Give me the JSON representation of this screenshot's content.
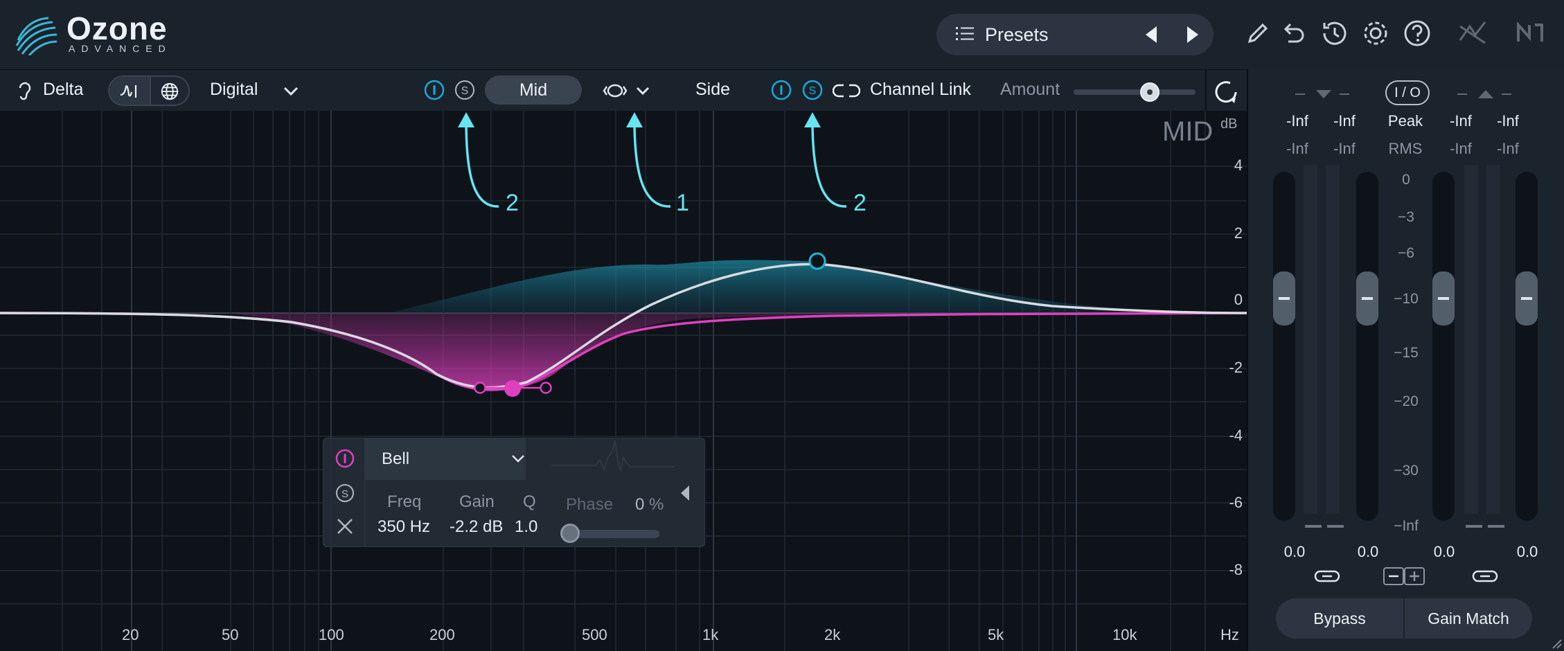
{
  "app": {
    "name": "Ozone",
    "edition": "ADVANCED"
  },
  "header": {
    "presets_label": "Presets",
    "icons": [
      "list-icon",
      "prev-preset-icon",
      "next-preset-icon",
      "pencil-icon",
      "undo-icon",
      "history-icon",
      "gear-icon",
      "help-icon",
      "signal-chain-icon",
      "ni-logo-icon"
    ]
  },
  "toolbar": {
    "delta_label": "Delta",
    "mode_label": "Digital",
    "mid_label": "Mid",
    "side_label": "Side",
    "channel_link_label": "Channel Link",
    "amount_label": "Amount",
    "amount_value": 0.62,
    "solo_letter": "S",
    "mid_power": "on",
    "side_power": "on",
    "side_solo": "on"
  },
  "eq": {
    "view_label": "MID",
    "db_unit": "dB",
    "db_ticks": [
      "4",
      "2",
      "0",
      "-2",
      "-4",
      "-6",
      "-8"
    ],
    "freq_ticks": [
      "20",
      "50",
      "100",
      "200",
      "500",
      "1k",
      "2k",
      "5k",
      "10k",
      "Hz"
    ],
    "annotations": [
      "2",
      "1",
      "2"
    ],
    "colors": {
      "mid_curve": "#e040c0",
      "side_curve": "#1ab8d8",
      "sum_curve": "#d7dbe0",
      "annotation": "#66e4f2"
    }
  },
  "band": {
    "type": "Bell",
    "freq_label": "Freq",
    "gain_label": "Gain",
    "q_label": "Q",
    "freq_value": "350 Hz",
    "gain_value": "-2.2 dB",
    "q_value": "1.0",
    "phase_label": "Phase",
    "phase_value": "0",
    "phase_unit": "%",
    "solo_letter": "S"
  },
  "meters": {
    "input_peaks": [
      "-Inf",
      "-Inf"
    ],
    "input_rms": [
      "-Inf",
      "-Inf"
    ],
    "output_peaks": [
      "-Inf",
      "-Inf"
    ],
    "output_rms": [
      "-Inf",
      "-Inf"
    ],
    "io_label": "I / O",
    "peak_label": "Peak",
    "rms_label": "RMS",
    "scale": [
      "0",
      "−3",
      "−6",
      "−10",
      "−15",
      "−20",
      "−30",
      "−Inf"
    ],
    "gain_values": [
      "0.0",
      "0.0",
      "0.0",
      "0.0"
    ],
    "bypass_label": "Bypass",
    "gain_match_label": "Gain Match"
  }
}
